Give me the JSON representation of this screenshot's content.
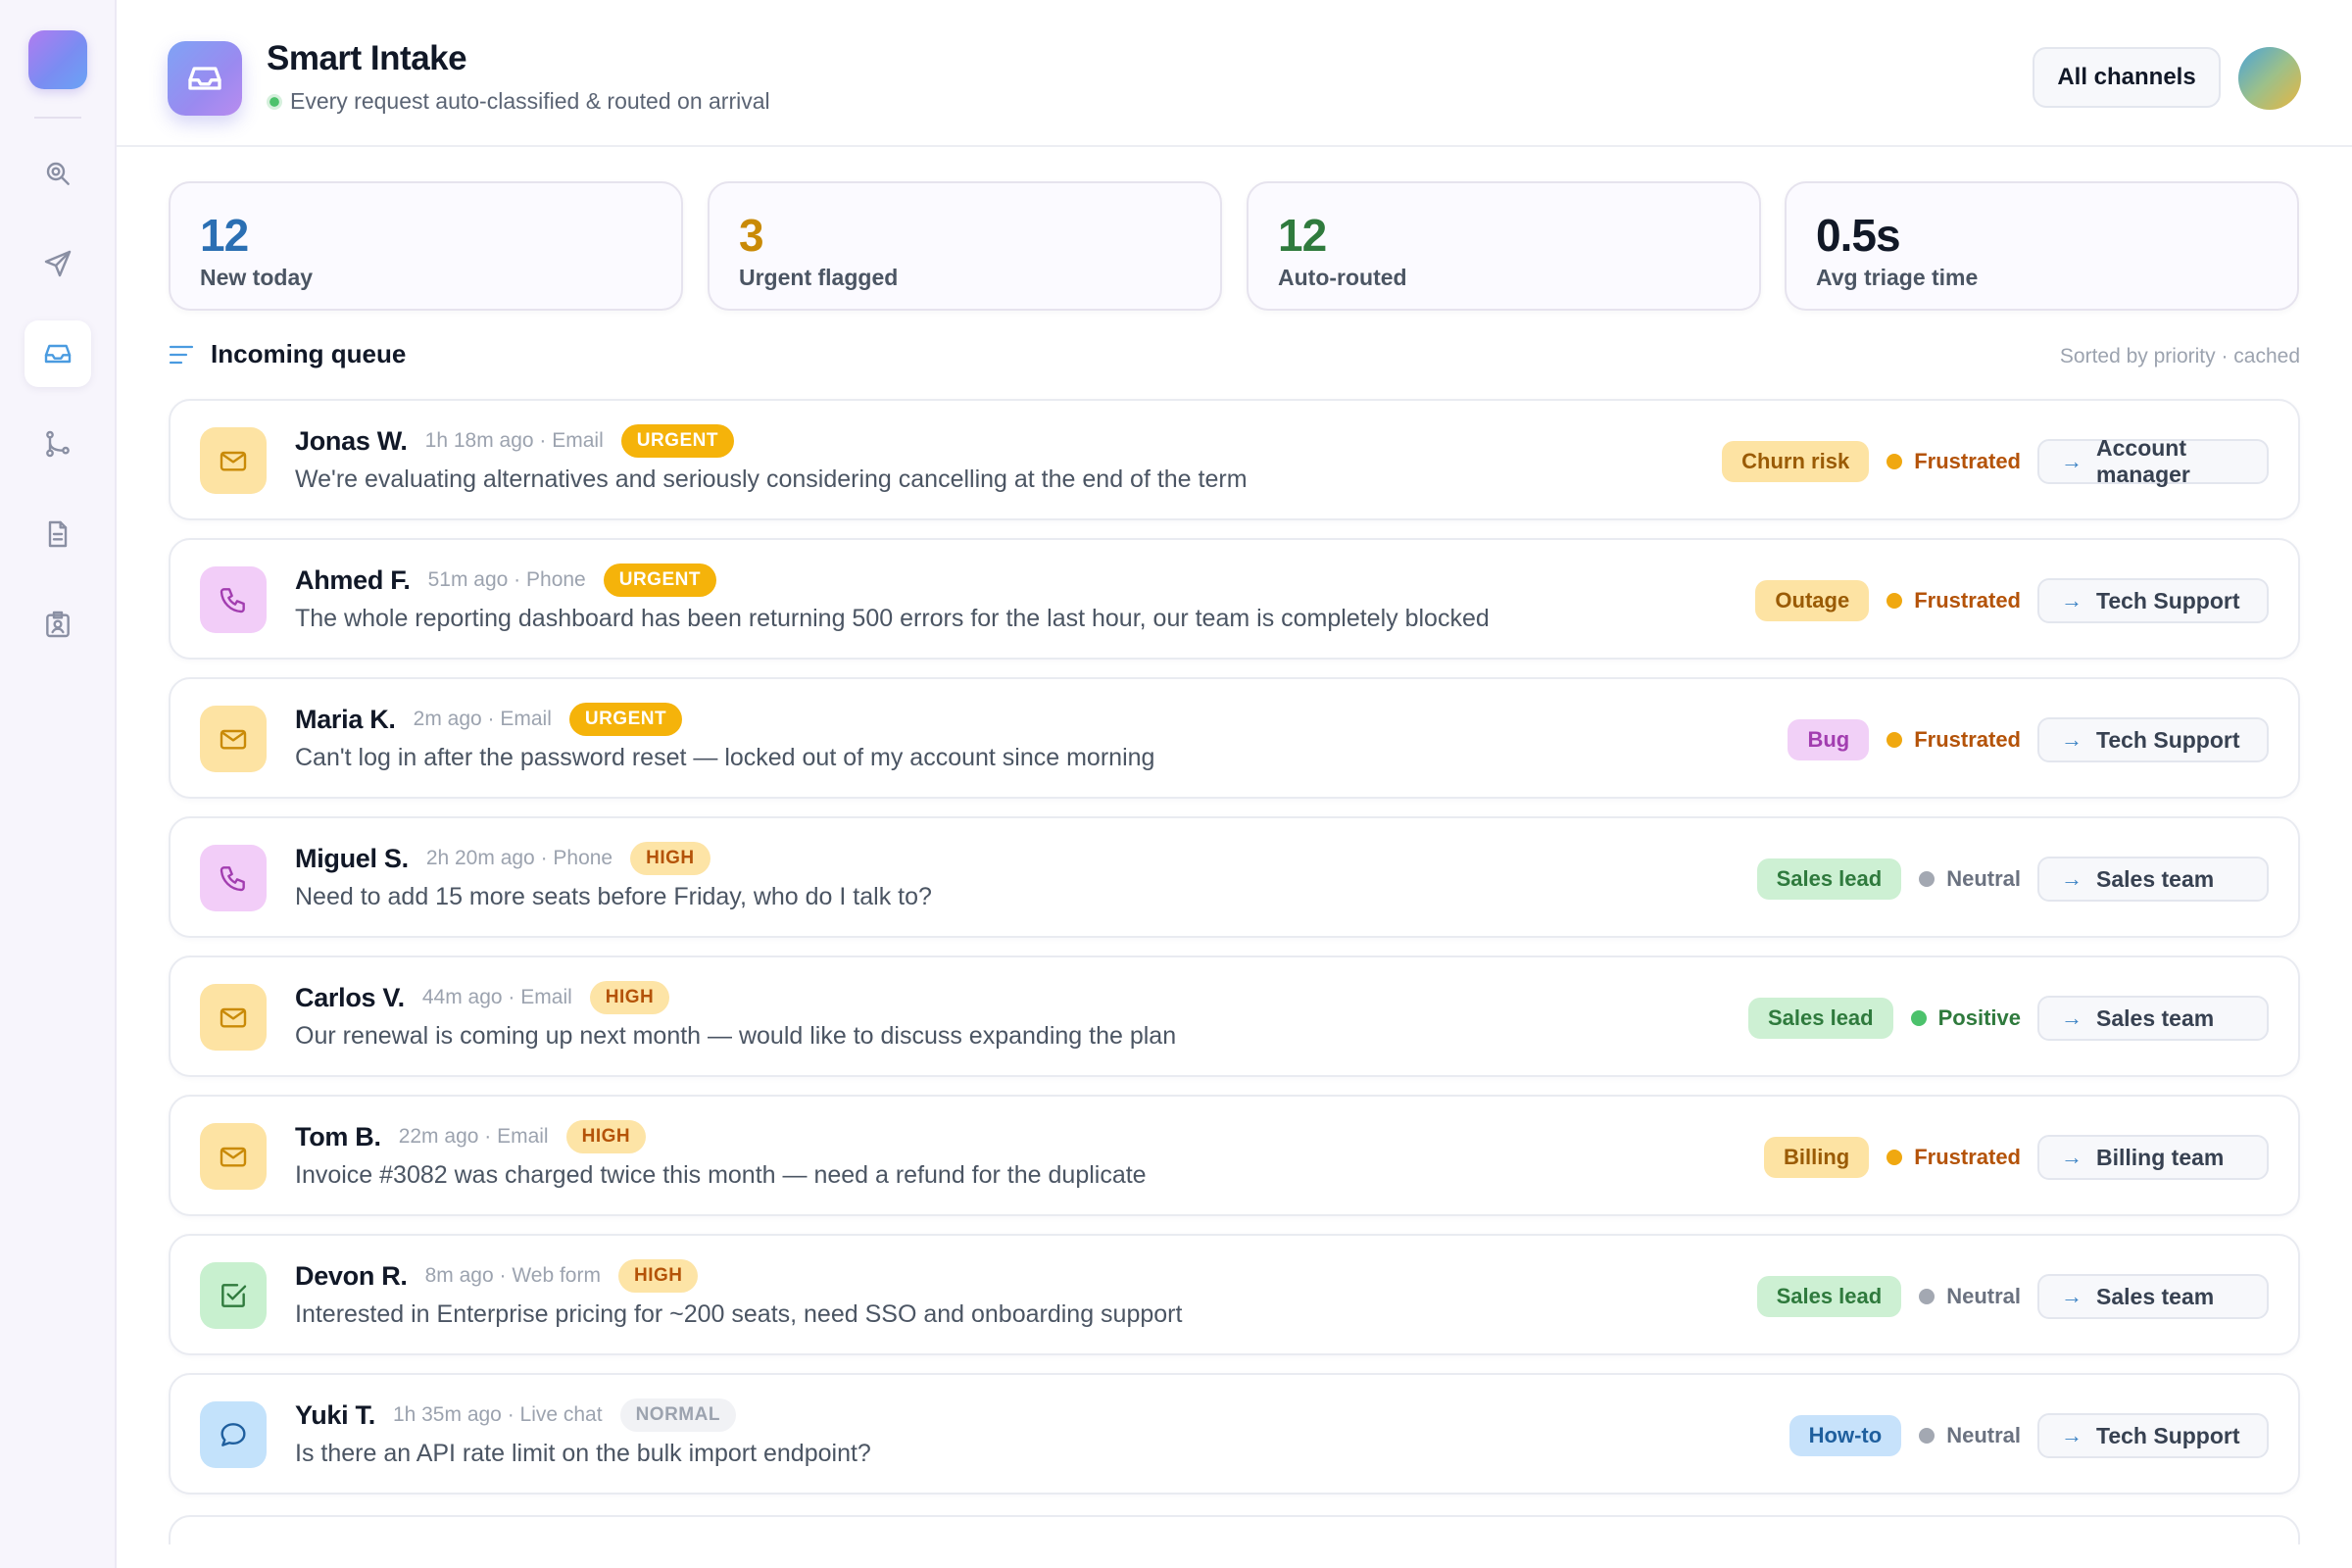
{
  "app": {
    "title": "Smart Intake",
    "subtitle": "Every request auto-classified & routed on arrival",
    "channels_button": "All channels"
  },
  "colors": {
    "urgent": "#f5b30a",
    "frustrated": "#f0a810",
    "neutral": "#a3a8b2",
    "positive": "#4cc26c",
    "accent_blue": "#3b82c4"
  },
  "stats": [
    {
      "value": "12",
      "label": "New today",
      "color": "#2b6fb3"
    },
    {
      "value": "3",
      "label": "Urgent flagged",
      "color": "#c98a07"
    },
    {
      "value": "12",
      "label": "Auto-routed",
      "color": "#2f7a3d"
    },
    {
      "value": "0.5s",
      "label": "Avg triage time",
      "color": "#111827"
    }
  ],
  "queue": {
    "title": "Incoming queue",
    "meta": "Sorted by priority · cached"
  },
  "rows": [
    {
      "name": "Jonas W.",
      "meta": "1h 18m ago · Email",
      "channel": "email",
      "priority": "URGENT",
      "priority_level": "urgent",
      "message": "We're evaluating alternatives and seriously considering cancelling at the end of the term",
      "tag": "Churn risk",
      "tag_style": "amber",
      "sentiment": "Frustrated",
      "sentiment_color": "#f0a810",
      "sentiment_text": "#b45309",
      "route": "Account manager"
    },
    {
      "name": "Ahmed F.",
      "meta": "51m ago · Phone",
      "channel": "phone",
      "priority": "URGENT",
      "priority_level": "urgent",
      "message": "The whole reporting dashboard has been returning 500 errors for the last hour, our team is completely blocked",
      "tag": "Outage",
      "tag_style": "amber",
      "sentiment": "Frustrated",
      "sentiment_color": "#f0a810",
      "sentiment_text": "#b45309",
      "route": "Tech Support"
    },
    {
      "name": "Maria K.",
      "meta": "2m ago · Email",
      "channel": "email",
      "priority": "URGENT",
      "priority_level": "urgent",
      "message": "Can't log in after the password reset — locked out of my account since morning",
      "tag": "Bug",
      "tag_style": "purple",
      "sentiment": "Frustrated",
      "sentiment_color": "#f0a810",
      "sentiment_text": "#b45309",
      "route": "Tech Support"
    },
    {
      "name": "Miguel S.",
      "meta": "2h 20m ago · Phone",
      "channel": "phone",
      "priority": "HIGH",
      "priority_level": "high",
      "message": "Need to add 15 more seats before Friday, who do I talk to?",
      "tag": "Sales lead",
      "tag_style": "green",
      "sentiment": "Neutral",
      "sentiment_color": "#a3a8b2",
      "sentiment_text": "#6b7280",
      "route": "Sales team"
    },
    {
      "name": "Carlos V.",
      "meta": "44m ago · Email",
      "channel": "email",
      "priority": "HIGH",
      "priority_level": "high",
      "message": "Our renewal is coming up next month — would like to discuss expanding the plan",
      "tag": "Sales lead",
      "tag_style": "green",
      "sentiment": "Positive",
      "sentiment_color": "#4cc26c",
      "sentiment_text": "#2f7a3d",
      "route": "Sales team"
    },
    {
      "name": "Tom B.",
      "meta": "22m ago · Email",
      "channel": "email",
      "priority": "HIGH",
      "priority_level": "high",
      "message": "Invoice #3082 was charged twice this month — need a refund for the duplicate",
      "tag": "Billing",
      "tag_style": "amber",
      "sentiment": "Frustrated",
      "sentiment_color": "#f0a810",
      "sentiment_text": "#b45309",
      "route": "Billing team"
    },
    {
      "name": "Devon R.",
      "meta": "8m ago · Web form",
      "channel": "form",
      "priority": "HIGH",
      "priority_level": "high",
      "message": "Interested in Enterprise pricing for ~200 seats, need SSO and onboarding support",
      "tag": "Sales lead",
      "tag_style": "green",
      "sentiment": "Neutral",
      "sentiment_color": "#a3a8b2",
      "sentiment_text": "#6b7280",
      "route": "Sales team"
    },
    {
      "name": "Yuki T.",
      "meta": "1h 35m ago · Live chat",
      "channel": "chat",
      "priority": "NORMAL",
      "priority_level": "normal",
      "message": "Is there an API rate limit on the bulk import endpoint?",
      "tag": "How-to",
      "tag_style": "blue",
      "sentiment": "Neutral",
      "sentiment_color": "#a3a8b2",
      "sentiment_text": "#6b7280",
      "route": "Tech Support"
    }
  ],
  "icons": {
    "sidebar": [
      "search-icon",
      "send-icon",
      "inbox-icon",
      "branch-icon",
      "document-icon",
      "contact-badge-icon"
    ],
    "channels": {
      "email": "mail-icon",
      "phone": "phone-icon",
      "form": "checkbox-icon",
      "chat": "chat-bubble-icon"
    }
  }
}
